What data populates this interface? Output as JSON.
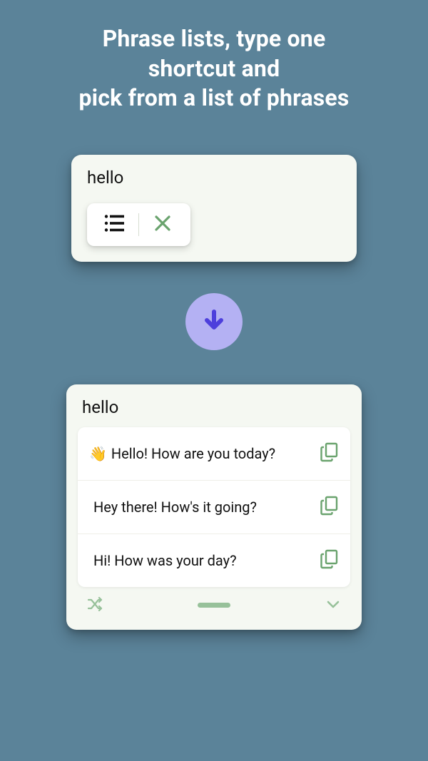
{
  "headline": {
    "line1": "Phrase lists, type one",
    "line2": "shortcut and",
    "line3": "pick from a list of phrases"
  },
  "input": {
    "typed": "hello"
  },
  "phrases": [
    {
      "emoji": "👋",
      "text": "Hello! How are you today?"
    },
    {
      "emoji": "",
      "text": "Hey there! How's it going?"
    },
    {
      "emoji": "",
      "text": "Hi! How was your day?"
    }
  ],
  "colors": {
    "accent_green": "#6aa36e",
    "accent_purple": "#4d3fdc",
    "circle_bg": "#b4b1f3",
    "page_bg": "#5b8399"
  }
}
